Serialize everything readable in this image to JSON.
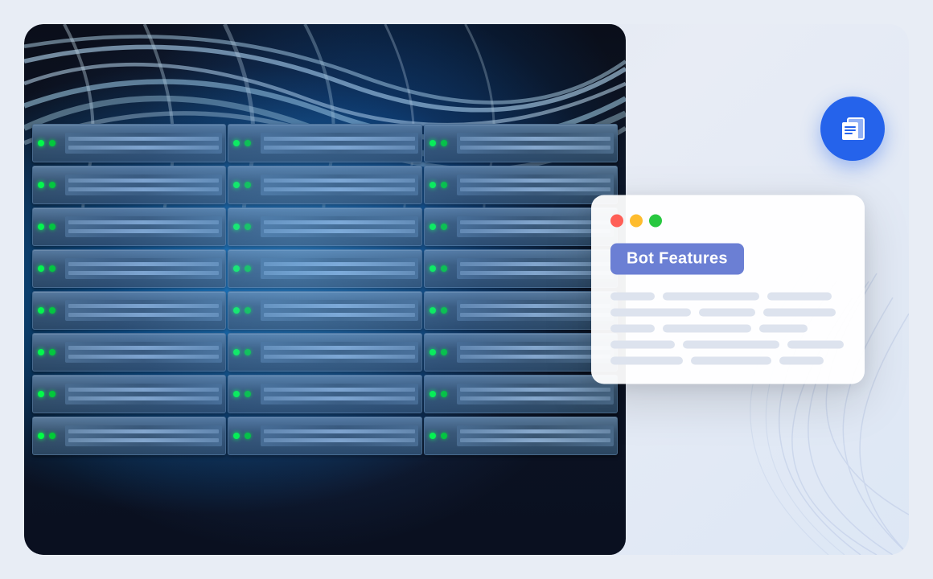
{
  "card": {
    "title": "Bot Features",
    "traffic_lights": [
      "red",
      "yellow",
      "green"
    ],
    "lines": [
      [
        "w1",
        "w2",
        "w3"
      ],
      [
        "w4",
        "w5"
      ],
      [
        "w2",
        "w6"
      ],
      [
        "w1",
        "w7",
        "w8"
      ],
      [
        "w3",
        "w2"
      ],
      [
        "w5",
        "w4",
        "w1"
      ]
    ]
  },
  "circle_icon": {
    "label": "documents-icon"
  },
  "colors": {
    "badge_bg": "#6b7fd4",
    "circle_bg": "#2563eb"
  }
}
